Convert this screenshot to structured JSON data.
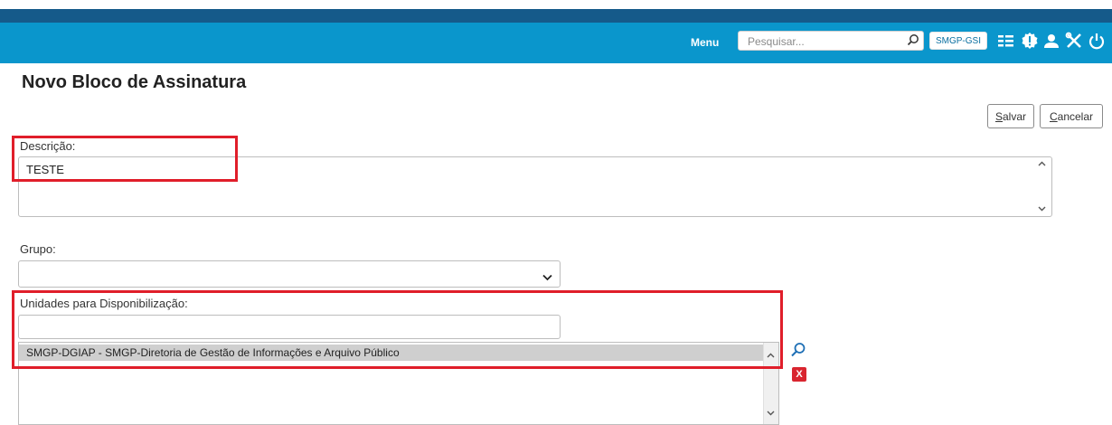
{
  "header": {
    "menu_label": "Menu",
    "search_placeholder": "Pesquisar...",
    "unit_badge": "SMGP-GSI",
    "icons": [
      "grid-list-icon",
      "alert-icon",
      "user-icon",
      "tools-icon",
      "power-icon"
    ],
    "bar_color": "#0a96cc",
    "strip_color": "#155a8a"
  },
  "page": {
    "title": "Novo Bloco de Assinatura"
  },
  "actions": {
    "save_label": "alvar",
    "save_access_key": "S",
    "cancel_label": "ancelar",
    "cancel_access_key": "C"
  },
  "form": {
    "descricao_label": "Descrição:",
    "descricao_value": "TESTE",
    "grupo_label": "Grupo:",
    "grupo_selected": "",
    "unidades_label": "Unidades para Disponibilização:",
    "unidades_input_value": "",
    "unidades_list": [
      "SMGP-DGIAP - SMGP-Diretoria de Gestão de Informações e Arquivo Público"
    ]
  },
  "highlight_color": "#e01e2a"
}
